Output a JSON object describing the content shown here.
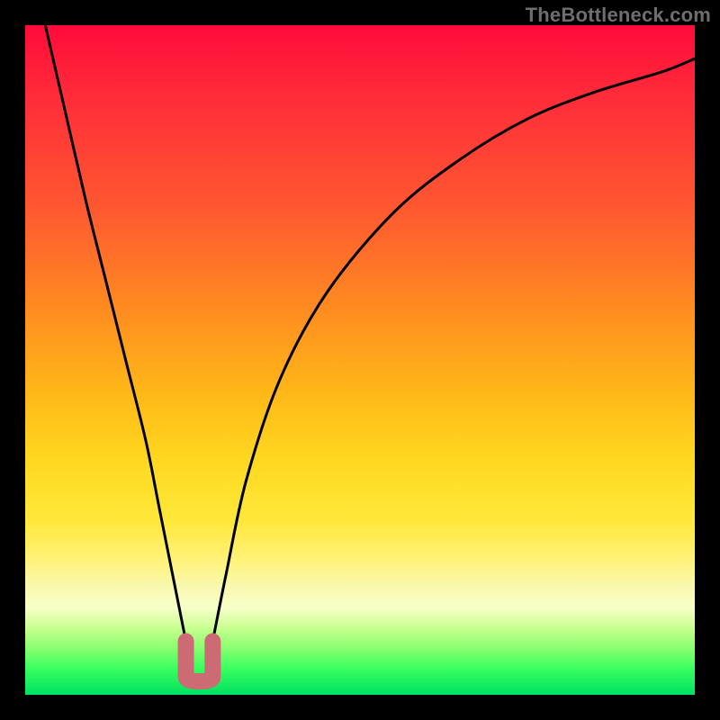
{
  "watermark": "TheBottleneck.com",
  "chart_data": {
    "type": "line",
    "title": "",
    "xlabel": "",
    "ylabel": "",
    "xlim": [
      0,
      100
    ],
    "ylim": [
      0,
      100
    ],
    "series": [
      {
        "name": "bottleneck-curve",
        "x": [
          3,
          6,
          9,
          12,
          15,
          18,
          20,
          22,
          24,
          25,
          26,
          27,
          28,
          30,
          33,
          38,
          45,
          55,
          65,
          75,
          85,
          95,
          100
        ],
        "values": [
          100,
          87,
          74,
          62,
          50,
          38,
          28,
          18,
          8,
          3,
          2,
          3,
          8,
          18,
          32,
          47,
          60,
          72,
          80,
          86,
          90,
          93,
          95
        ]
      }
    ],
    "annotations": [
      {
        "name": "minimum-marker",
        "x_range": [
          24,
          28
        ],
        "y_range": [
          2,
          8
        ],
        "color": "#cc6b74"
      }
    ],
    "colors": {
      "curve": "#000000",
      "marker": "#cc6b74",
      "gradient_top": "#ff0a3a",
      "gradient_bottom": "#00e060"
    }
  }
}
